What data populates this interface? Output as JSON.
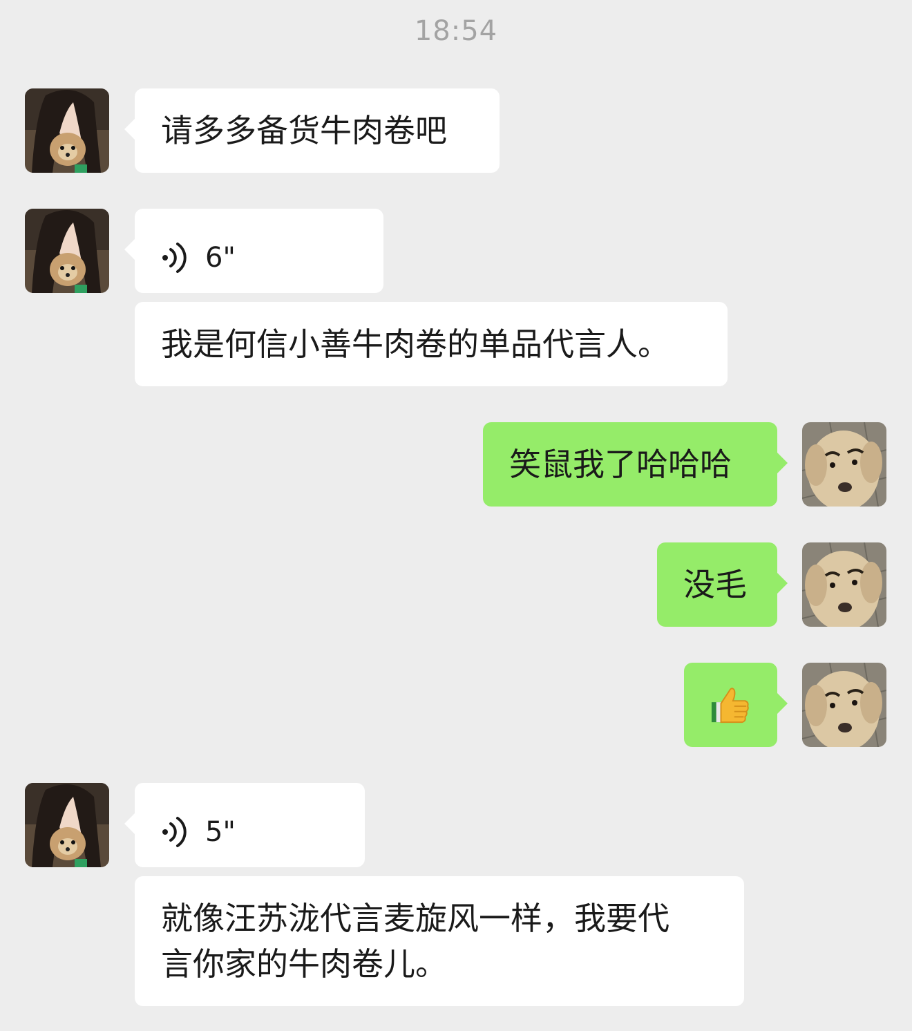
{
  "time": "18:54",
  "messages": [
    {
      "type": "text",
      "from": "other",
      "text": "请多多备货牛肉卷吧"
    },
    {
      "type": "voice",
      "from": "other",
      "duration": "6\""
    },
    {
      "type": "text",
      "from": "other",
      "text": "我是何信小善牛肉卷的单品代言人。"
    },
    {
      "type": "text",
      "from": "me",
      "text": "笑鼠我了哈哈哈"
    },
    {
      "type": "text",
      "from": "me",
      "text": "没毛"
    },
    {
      "type": "emoji",
      "from": "me",
      "emoji": "thumbs-up-icon"
    },
    {
      "type": "voice",
      "from": "other",
      "duration": "5\""
    },
    {
      "type": "text",
      "from": "other",
      "text": "就像汪苏泷代言麦旋风一样，我要代\n言你家的牛肉卷儿。"
    }
  ],
  "colors": {
    "background": "#ededed",
    "incoming_bubble": "#ffffff",
    "outgoing_bubble": "#95ec69",
    "timestamp": "#a3a3a3"
  }
}
